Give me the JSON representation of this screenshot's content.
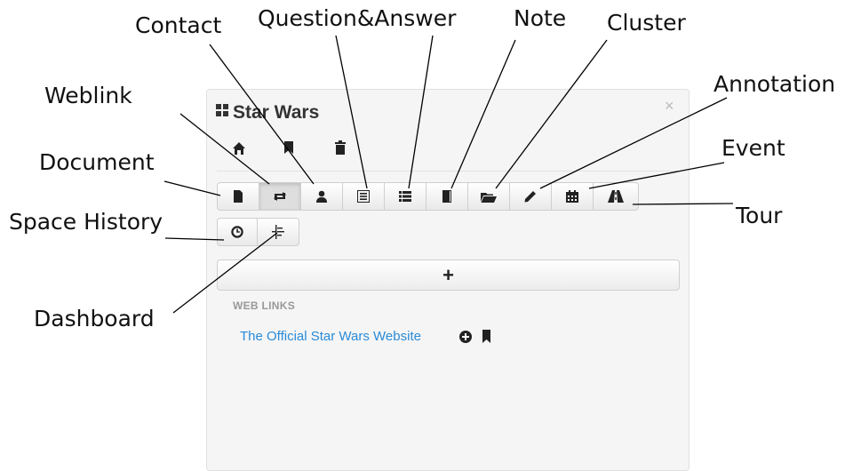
{
  "callouts": {
    "contact": "Contact",
    "qa": "Question&Answer",
    "note": "Note",
    "cluster": "Cluster",
    "weblink": "Weblink",
    "annotation": "Annotation",
    "event": "Event",
    "document": "Document",
    "tour": "Tour",
    "space_history": "Space History",
    "dashboard": "Dashboard"
  },
  "panel": {
    "title": "Star Wars",
    "close_symbol": "×",
    "section_label": "WEB LINKS",
    "link_text": "The Official Star Wars Website"
  },
  "toolbar": {
    "row1": [
      "file-icon",
      "retweet-icon",
      "user-icon",
      "list-alt-icon",
      "list-icon",
      "book-icon",
      "folder-open-icon",
      "pencil-icon",
      "calendar-icon",
      "road-icon"
    ],
    "row2": [
      "time-icon",
      "dashboard-icon"
    ],
    "active": "retweet-icon"
  },
  "add_symbol": "+"
}
